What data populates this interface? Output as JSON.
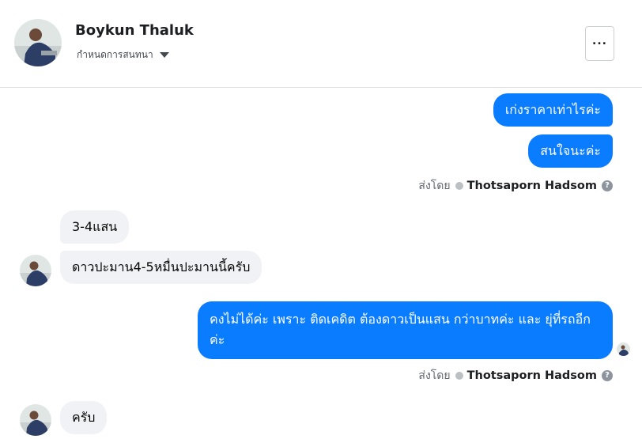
{
  "header": {
    "contact_name": "Boykun Thaluk",
    "status": "กำหนดการสนทนา",
    "more_label": "..."
  },
  "messages": [
    {
      "text": "เก่งราคาเท่าไรค่ะ"
    },
    {
      "text": "สนใจนะค่ะ"
    },
    {
      "text": "3-4แสน"
    },
    {
      "text": "ดาวปะมาน4-5หมื่นปะมานนี้ครับ"
    },
    {
      "text": "คงไม่ได้ค่ะ เพราะ ติดเคดิต ต้องดาวเป็นแสน กว่าบาทค่ะ และ ยุ่ที่รถอีกค่ะ"
    },
    {
      "text": "ครับ"
    }
  ],
  "sent_by": {
    "prefix": "ส่งโดย",
    "sender": "Thotsaporn Hadsom",
    "help": "?"
  },
  "colors": {
    "outgoing_bubble": "#0a7cff",
    "incoming_bubble": "#f0f2f5"
  }
}
